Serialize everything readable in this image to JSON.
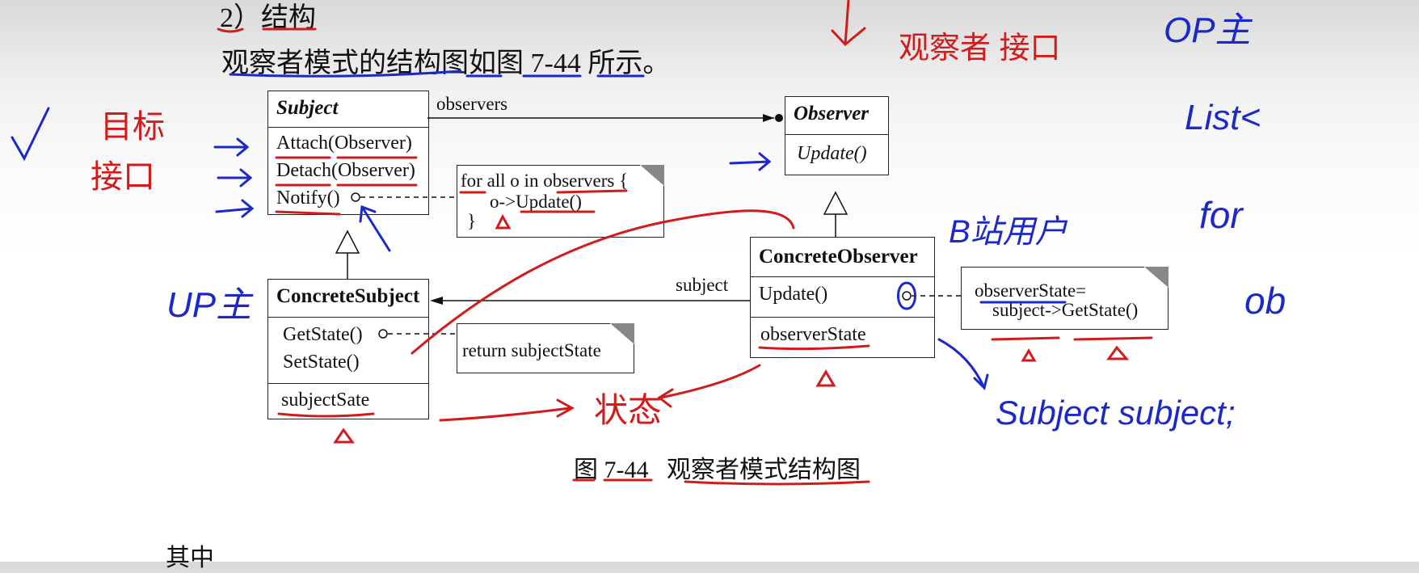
{
  "heading": {
    "number": "2）",
    "title": "结构"
  },
  "intro": "观察者模式的结构图如图 7-44 所示。",
  "diagram": {
    "subject": {
      "name": "Subject",
      "ops": [
        "Attach(Observer)",
        "Detach(Observer)",
        "Notify()"
      ]
    },
    "observer": {
      "name": "Observer",
      "ops": [
        "Update()"
      ]
    },
    "concrete_subject": {
      "name": "ConcreteSubject",
      "ops": [
        "GetState()",
        "SetState()"
      ],
      "attrs": [
        "subjectSate"
      ]
    },
    "concrete_observer": {
      "name": "ConcreteObserver",
      "ops": [
        "Update()"
      ],
      "attrs": [
        "observerState"
      ]
    },
    "notes": {
      "notify": [
        "for all o in observers {",
        "o->Update()",
        "}"
      ],
      "getstate": [
        "return subjectState"
      ],
      "update": [
        "observerState=",
        "subject->GetState()"
      ]
    },
    "assoc_labels": {
      "observers": "observers",
      "subject": "subject"
    }
  },
  "caption": {
    "fig": "图 7-44",
    "title": "观察者模式结构图"
  },
  "footer_fragment": "其中",
  "annotations": {
    "red": [
      "目标",
      "接口",
      "观察者 接口",
      "状态"
    ],
    "blue": [
      "OP主",
      "B站用户",
      "UP主",
      "List<",
      "for",
      "ob",
      "Subject subject;"
    ]
  }
}
